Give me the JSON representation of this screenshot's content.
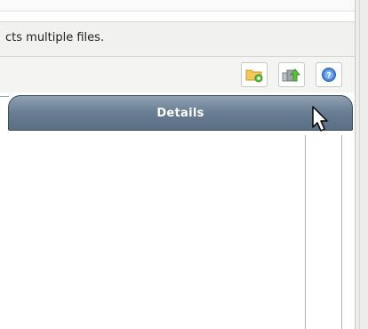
{
  "status_message": "cts multiple files.",
  "toolbar": {
    "buttons": [
      {
        "icon": "new-folder-icon"
      },
      {
        "icon": "upload-icon"
      },
      {
        "icon": "help-icon"
      }
    ]
  },
  "tabs": [
    {
      "label": "Details",
      "active": true
    }
  ],
  "colors": {
    "tab_gradient_top": "#8fa1b2",
    "tab_gradient_bottom": "#5a6f83",
    "info_bar_bg": "#f1f1f0",
    "folder_icon": "#f2c75c",
    "upload_arrow": "#5cbf3e",
    "help_icon": "#4a86d6"
  }
}
